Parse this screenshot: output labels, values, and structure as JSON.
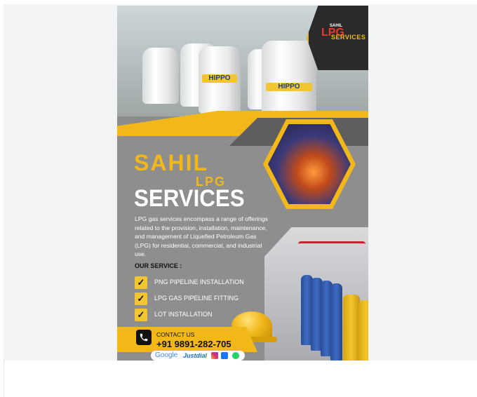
{
  "poster": {
    "tank_brand": "HIPPO",
    "logo_top": "SAHIL",
    "logo_mark": "LPG",
    "logo_services": "SERVICES",
    "title_sahil": "SAHIL",
    "title_lpg": "LPG",
    "title_services": "SERVICES",
    "description": "LPG gas services encompass a range of offerings related to the provision, installation, maintenance, and management of Liquefied Petroleum Gas (LPG) for residential, commercial, and industrial use.",
    "service_heading": "OUR SERVICE :",
    "services": [
      {
        "label": "PNG PIPELINE INSTALLATION"
      },
      {
        "label": "LPG GAS PIPELINE FITTING"
      },
      {
        "label": "LOT INSTALLATION"
      }
    ],
    "check_glyph": "✓",
    "contact_label": "CONTACT US",
    "contact_phone": "+91 9891-282-705",
    "google": "Google",
    "justdial": "Justdial"
  },
  "colors": {
    "brand_yellow": "#f2b81a",
    "panel_grey": "#8e8e8e",
    "logo_red": "#e63a2f",
    "dark": "#2a2a2a"
  },
  "icons": [
    "phone-icon",
    "check-icon",
    "instagram-icon",
    "facebook-icon",
    "whatsapp-icon"
  ]
}
